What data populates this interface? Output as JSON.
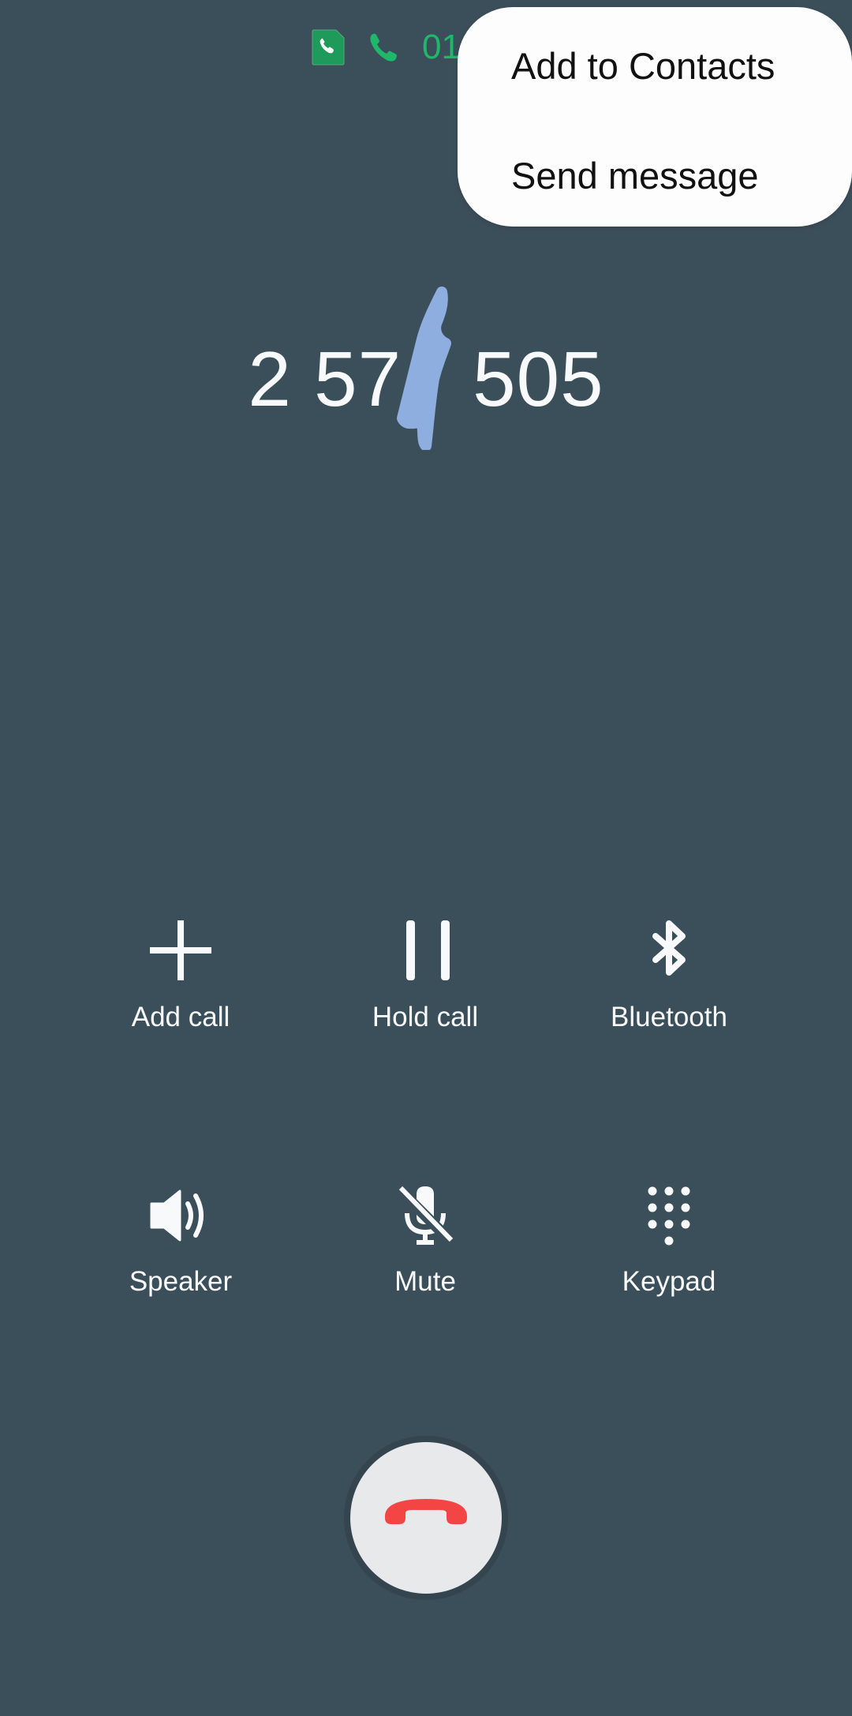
{
  "status": {
    "sim_icon": "sim-card-phone-icon",
    "call_icon": "phone-icon",
    "call_timer": "01",
    "accent_color": "#1fb86b"
  },
  "call": {
    "number_part_before": "2 57",
    "number_part_after": "505",
    "redaction_note": "middle digits obscured by scribble"
  },
  "controls": [
    {
      "label": "Add call",
      "icon": "plus-icon"
    },
    {
      "label": "Hold call",
      "icon": "pause-icon"
    },
    {
      "label": "Bluetooth",
      "icon": "bluetooth-icon"
    },
    {
      "label": "Speaker",
      "icon": "speaker-icon"
    },
    {
      "label": "Mute",
      "icon": "mic-off-icon"
    },
    {
      "label": "Keypad",
      "icon": "dialpad-icon"
    }
  ],
  "end_call": {
    "icon": "call-end-icon",
    "color": "#f44545"
  },
  "menu": {
    "items": [
      {
        "label": "Add to Contacts"
      },
      {
        "label": "Send message"
      }
    ]
  },
  "colors": {
    "background": "#3b4f5b",
    "redaction": "#8eaee0"
  }
}
